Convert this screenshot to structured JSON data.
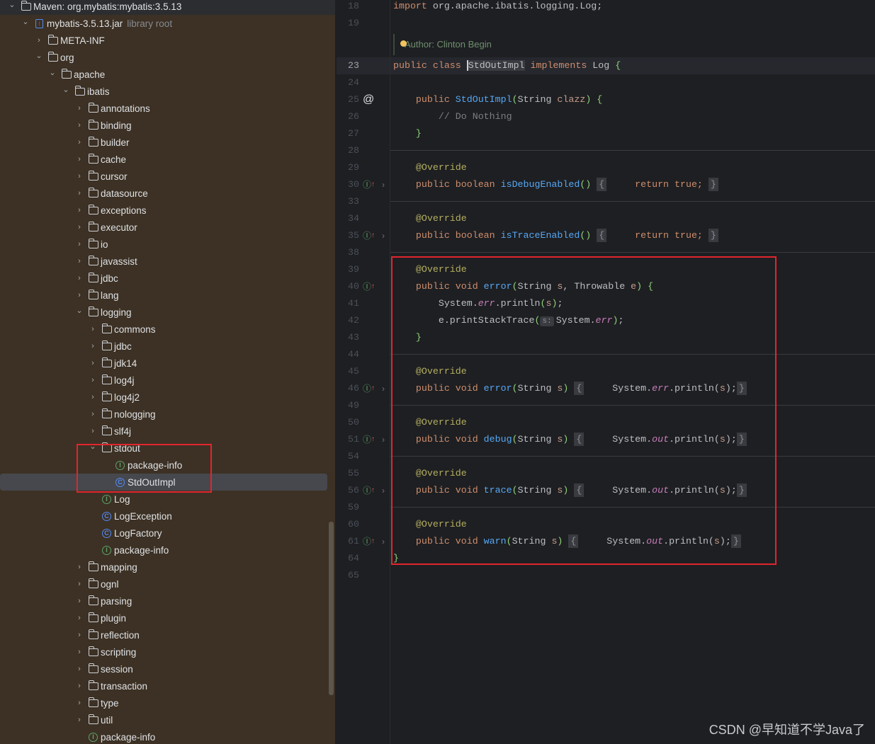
{
  "tree": {
    "items": [
      {
        "label": "Maven: org.mybatis:mybatis:3.5.13",
        "level": 0,
        "arrow": "down",
        "icon": "maven-library-icon"
      },
      {
        "label": "mybatis-3.5.13.jar",
        "hint": "library root",
        "level": 1,
        "arrow": "down",
        "icon": "jar-icon"
      },
      {
        "label": "META-INF",
        "level": 2,
        "arrow": "right",
        "icon": "folder-icon"
      },
      {
        "label": "org",
        "level": 2,
        "arrow": "down",
        "icon": "folder-icon"
      },
      {
        "label": "apache",
        "level": 3,
        "arrow": "down",
        "icon": "folder-icon"
      },
      {
        "label": "ibatis",
        "level": 4,
        "arrow": "down",
        "icon": "folder-icon"
      },
      {
        "label": "annotations",
        "level": 5,
        "arrow": "right",
        "icon": "folder-icon"
      },
      {
        "label": "binding",
        "level": 5,
        "arrow": "right",
        "icon": "folder-icon"
      },
      {
        "label": "builder",
        "level": 5,
        "arrow": "right",
        "icon": "folder-icon"
      },
      {
        "label": "cache",
        "level": 5,
        "arrow": "right",
        "icon": "folder-icon"
      },
      {
        "label": "cursor",
        "level": 5,
        "arrow": "right",
        "icon": "folder-icon"
      },
      {
        "label": "datasource",
        "level": 5,
        "arrow": "right",
        "icon": "folder-icon"
      },
      {
        "label": "exceptions",
        "level": 5,
        "arrow": "right",
        "icon": "folder-icon"
      },
      {
        "label": "executor",
        "level": 5,
        "arrow": "right",
        "icon": "folder-icon"
      },
      {
        "label": "io",
        "level": 5,
        "arrow": "right",
        "icon": "folder-icon"
      },
      {
        "label": "javassist",
        "level": 5,
        "arrow": "right",
        "icon": "folder-icon"
      },
      {
        "label": "jdbc",
        "level": 5,
        "arrow": "right",
        "icon": "folder-icon"
      },
      {
        "label": "lang",
        "level": 5,
        "arrow": "right",
        "icon": "folder-icon"
      },
      {
        "label": "logging",
        "level": 5,
        "arrow": "down",
        "icon": "folder-icon"
      },
      {
        "label": "commons",
        "level": 6,
        "arrow": "right",
        "icon": "folder-icon"
      },
      {
        "label": "jdbc",
        "level": 6,
        "arrow": "right",
        "icon": "folder-icon"
      },
      {
        "label": "jdk14",
        "level": 6,
        "arrow": "right",
        "icon": "folder-icon"
      },
      {
        "label": "log4j",
        "level": 6,
        "arrow": "right",
        "icon": "folder-icon"
      },
      {
        "label": "log4j2",
        "level": 6,
        "arrow": "right",
        "icon": "folder-icon"
      },
      {
        "label": "nologging",
        "level": 6,
        "arrow": "right",
        "icon": "folder-icon"
      },
      {
        "label": "slf4j",
        "level": 6,
        "arrow": "right",
        "icon": "folder-icon"
      },
      {
        "label": "stdout",
        "level": 6,
        "arrow": "down",
        "icon": "folder-icon"
      },
      {
        "label": "package-info",
        "level": 7,
        "icon": "interface-icon"
      },
      {
        "label": "StdOutImpl",
        "level": 7,
        "icon": "class-icon",
        "selected": true
      },
      {
        "label": "Log",
        "level": 6,
        "icon": "interface-icon"
      },
      {
        "label": "LogException",
        "level": 6,
        "icon": "class-icon"
      },
      {
        "label": "LogFactory",
        "level": 6,
        "icon": "class-icon"
      },
      {
        "label": "package-info",
        "level": 6,
        "icon": "interface-icon"
      },
      {
        "label": "mapping",
        "level": 5,
        "arrow": "right",
        "icon": "folder-icon"
      },
      {
        "label": "ognl",
        "level": 5,
        "arrow": "right",
        "icon": "folder-icon"
      },
      {
        "label": "parsing",
        "level": 5,
        "arrow": "right",
        "icon": "folder-icon"
      },
      {
        "label": "plugin",
        "level": 5,
        "arrow": "right",
        "icon": "folder-icon"
      },
      {
        "label": "reflection",
        "level": 5,
        "arrow": "right",
        "icon": "folder-icon"
      },
      {
        "label": "scripting",
        "level": 5,
        "arrow": "right",
        "icon": "folder-icon"
      },
      {
        "label": "session",
        "level": 5,
        "arrow": "right",
        "icon": "folder-icon"
      },
      {
        "label": "transaction",
        "level": 5,
        "arrow": "right",
        "icon": "folder-icon"
      },
      {
        "label": "type",
        "level": 5,
        "arrow": "right",
        "icon": "folder-icon"
      },
      {
        "label": "util",
        "level": 5,
        "arrow": "right",
        "icon": "folder-icon"
      },
      {
        "label": "package-info",
        "level": 5,
        "icon": "interface-icon"
      }
    ]
  },
  "editor": {
    "author_hint": "Author: Clinton Begin",
    "current_line": "23",
    "lines": [
      {
        "n": "18",
        "t": [
          [
            "import ",
            "kw"
          ],
          [
            "org.apache.ibatis.logging.Log;",
            ""
          ]
        ]
      },
      {
        "n": "19",
        "t": []
      },
      {
        "n": "23",
        "t": [
          [
            "public class ",
            "kw"
          ],
          [
            "StdOutImpl",
            "sel-name"
          ],
          [
            " implements ",
            "kw"
          ],
          [
            "Log ",
            ""
          ],
          [
            "{",
            "br"
          ]
        ]
      },
      {
        "n": "24",
        "t": []
      },
      {
        "n": "25",
        "g": "at",
        "t": [
          [
            "    public ",
            "kw"
          ],
          [
            "StdOutImpl",
            "fn"
          ],
          [
            "(",
            "br"
          ],
          [
            "String ",
            ""
          ],
          [
            "clazz",
            "pa"
          ],
          [
            ")",
            "br"
          ],
          [
            " ",
            ""
          ],
          [
            "{",
            "br"
          ]
        ]
      },
      {
        "n": "26",
        "t": [
          [
            "        // Do Nothing",
            "cm"
          ]
        ]
      },
      {
        "n": "27",
        "t": [
          [
            "    ",
            ""
          ],
          [
            "}",
            "br"
          ]
        ]
      },
      {
        "n": "28",
        "t": []
      },
      {
        "n": "29",
        "sep": true,
        "t": [
          [
            "    @Override",
            "an"
          ]
        ]
      },
      {
        "n": "30",
        "g": "impl",
        "fold": true,
        "t": [
          [
            "    public boolean ",
            "kw"
          ],
          [
            "isDebugEnabled",
            "fn"
          ],
          [
            "()",
            "br"
          ],
          [
            " ",
            ""
          ],
          [
            "{",
            "fold"
          ],
          [
            "     return true;",
            "kw"
          ],
          [
            " ",
            ""
          ],
          [
            "}",
            "fold"
          ]
        ]
      },
      {
        "n": "33",
        "t": []
      },
      {
        "n": "34",
        "sep": true,
        "t": [
          [
            "    @Override",
            "an"
          ]
        ]
      },
      {
        "n": "35",
        "g": "impl",
        "fold": true,
        "t": [
          [
            "    public boolean ",
            "kw"
          ],
          [
            "isTraceEnabled",
            "fn"
          ],
          [
            "()",
            "br"
          ],
          [
            " ",
            ""
          ],
          [
            "{",
            "fold"
          ],
          [
            "     return true;",
            "kw"
          ],
          [
            " ",
            ""
          ],
          [
            "}",
            "fold"
          ]
        ]
      },
      {
        "n": "38",
        "t": []
      },
      {
        "n": "39",
        "sep": true,
        "t": [
          [
            "    @Override",
            "an"
          ]
        ]
      },
      {
        "n": "40",
        "g": "impl",
        "t": [
          [
            "    public void ",
            "kw"
          ],
          [
            "error",
            "fn"
          ],
          [
            "(",
            "br"
          ],
          [
            "String ",
            ""
          ],
          [
            "s",
            "pa"
          ],
          [
            ", Throwable ",
            ""
          ],
          [
            "e",
            "pa"
          ],
          [
            ")",
            "br"
          ],
          [
            " ",
            ""
          ],
          [
            "{",
            "br"
          ]
        ]
      },
      {
        "n": "41",
        "t": [
          [
            "        System.",
            ""
          ],
          [
            "err",
            "st"
          ],
          [
            ".println",
            ""
          ],
          [
            "(",
            "br"
          ],
          [
            "s",
            "pa"
          ],
          [
            ")",
            "br"
          ],
          [
            ";",
            ""
          ]
        ]
      },
      {
        "n": "42",
        "t": [
          [
            "        e.printStackTrace",
            ""
          ],
          [
            "(",
            "br"
          ],
          [
            "s:",
            "inl"
          ],
          [
            "System.",
            ""
          ],
          [
            "err",
            "st"
          ],
          [
            ")",
            "br"
          ],
          [
            ";",
            ""
          ]
        ]
      },
      {
        "n": "43",
        "t": [
          [
            "    ",
            ""
          ],
          [
            "}",
            "br"
          ]
        ]
      },
      {
        "n": "44",
        "t": []
      },
      {
        "n": "45",
        "sep": true,
        "t": [
          [
            "    @Override",
            "an"
          ]
        ]
      },
      {
        "n": "46",
        "g": "impl",
        "fold": true,
        "t": [
          [
            "    public void ",
            "kw"
          ],
          [
            "error",
            "fn"
          ],
          [
            "(",
            "br"
          ],
          [
            "String ",
            ""
          ],
          [
            "s",
            "pa"
          ],
          [
            ")",
            "br"
          ],
          [
            " ",
            ""
          ],
          [
            "{",
            "fold"
          ],
          [
            "     System.",
            ""
          ],
          [
            "err",
            "st"
          ],
          [
            ".println(",
            ""
          ],
          [
            "s",
            "pa"
          ],
          [
            ");",
            ""
          ],
          [
            "}",
            "fold"
          ]
        ]
      },
      {
        "n": "49",
        "t": []
      },
      {
        "n": "50",
        "sep": true,
        "t": [
          [
            "    @Override",
            "an"
          ]
        ]
      },
      {
        "n": "51",
        "g": "impl",
        "fold": true,
        "t": [
          [
            "    public void ",
            "kw"
          ],
          [
            "debug",
            "fn"
          ],
          [
            "(",
            "br"
          ],
          [
            "String ",
            ""
          ],
          [
            "s",
            "pa"
          ],
          [
            ")",
            "br"
          ],
          [
            " ",
            ""
          ],
          [
            "{",
            "fold"
          ],
          [
            "     System.",
            ""
          ],
          [
            "out",
            "st"
          ],
          [
            ".println(",
            ""
          ],
          [
            "s",
            "pa"
          ],
          [
            ");",
            ""
          ],
          [
            "}",
            "fold"
          ]
        ]
      },
      {
        "n": "54",
        "t": []
      },
      {
        "n": "55",
        "sep": true,
        "t": [
          [
            "    @Override",
            "an"
          ]
        ]
      },
      {
        "n": "56",
        "g": "impl",
        "fold": true,
        "t": [
          [
            "    public void ",
            "kw"
          ],
          [
            "trace",
            "fn"
          ],
          [
            "(",
            "br"
          ],
          [
            "String ",
            ""
          ],
          [
            "s",
            "pa"
          ],
          [
            ")",
            "br"
          ],
          [
            " ",
            ""
          ],
          [
            "{",
            "fold"
          ],
          [
            "     System.",
            ""
          ],
          [
            "out",
            "st"
          ],
          [
            ".println(",
            ""
          ],
          [
            "s",
            "pa"
          ],
          [
            ");",
            ""
          ],
          [
            "}",
            "fold"
          ]
        ]
      },
      {
        "n": "59",
        "t": []
      },
      {
        "n": "60",
        "sep": true,
        "t": [
          [
            "    @Override",
            "an"
          ]
        ]
      },
      {
        "n": "61",
        "g": "impl",
        "fold": true,
        "t": [
          [
            "    public void ",
            "kw"
          ],
          [
            "warn",
            "fn"
          ],
          [
            "(",
            "br"
          ],
          [
            "String ",
            ""
          ],
          [
            "s",
            "pa"
          ],
          [
            ")",
            "br"
          ],
          [
            " ",
            ""
          ],
          [
            "{",
            "fold"
          ],
          [
            "     System.",
            ""
          ],
          [
            "out",
            "st"
          ],
          [
            ".println(",
            ""
          ],
          [
            "s",
            "pa"
          ],
          [
            ");",
            ""
          ],
          [
            "}",
            "fold"
          ]
        ]
      },
      {
        "n": "64",
        "t": [
          [
            "}",
            "br"
          ]
        ]
      },
      {
        "n": "65",
        "t": []
      }
    ]
  },
  "watermark": "CSDN @早知道不学Java了",
  "colors": {
    "highlight_box": "#e3252d",
    "sidebar_bg": "#3c3124",
    "editor_bg": "#1e1f22"
  }
}
